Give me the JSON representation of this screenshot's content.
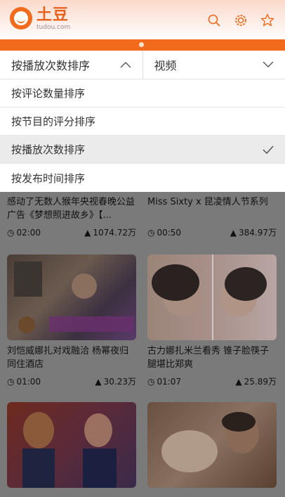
{
  "header": {
    "logo_cn": "土豆",
    "logo_en": "tudou.com",
    "icons": [
      "search-icon",
      "settings-icon",
      "star-icon"
    ]
  },
  "filters": {
    "sort_label": "按播放次数排序",
    "category_label": "视频"
  },
  "sort_options": [
    {
      "label": "按评论数量排序",
      "selected": false
    },
    {
      "label": "按节目的评分排序",
      "selected": false
    },
    {
      "label": "按播放次数排序",
      "selected": true
    },
    {
      "label": "按发布时间排序",
      "selected": false
    }
  ],
  "videos": [
    {
      "title": "感动了无数人猴年央视春晚公益广告《梦想照进故乡》【...",
      "duration": "02:00",
      "plays": "1074.72万"
    },
    {
      "title": "Miss Sixty x 昆凌情人节系列",
      "duration": "00:50",
      "plays": "384.97万"
    },
    {
      "title": "刘恺威娜扎对戏融洽 杨幂夜归同住酒店",
      "duration": "01:00",
      "plays": "30.23万"
    },
    {
      "title": "古力娜扎米兰看秀 锥子脸筷子腿堪比郑爽",
      "duration": "01:07",
      "plays": "25.89万"
    }
  ],
  "colors": {
    "accent": "#f26a1b",
    "overlay": "#7a7a7a"
  }
}
